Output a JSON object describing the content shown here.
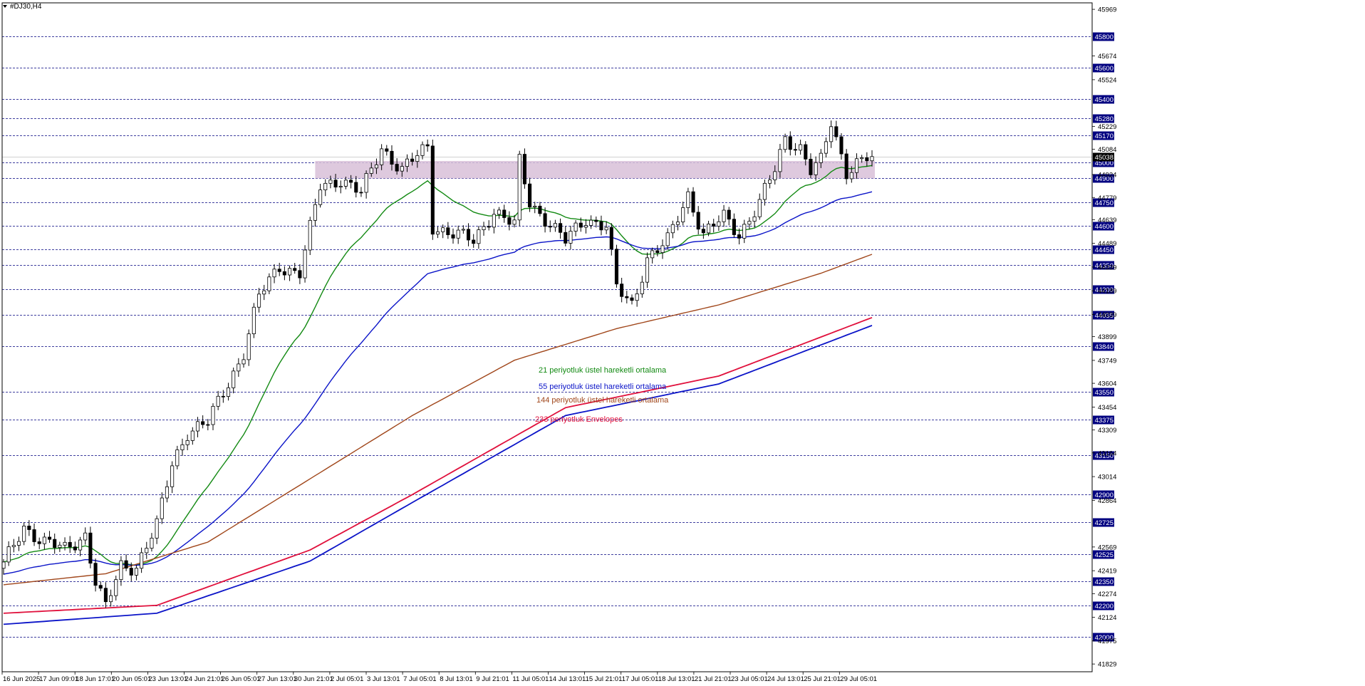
{
  "window": {
    "symbol_title": "#DJ30,H4"
  },
  "chart_data": {
    "type": "candlestick",
    "price_axis_ticks": [
      45969,
      45674,
      45524,
      45229,
      45084,
      44924,
      44779,
      44639,
      44489,
      44339,
      44189,
      44039,
      43899,
      43749,
      43604,
      43454,
      43309,
      43164,
      43014,
      42864,
      42569,
      42419,
      42274,
      42124,
      41975,
      41829
    ],
    "level_lines": [
      45800,
      45600,
      45400,
      45280,
      45170,
      45000,
      44900,
      44750,
      44600,
      44450,
      44350,
      44200,
      44035,
      43840,
      43550,
      43375,
      43150,
      42900,
      42725,
      42525,
      42350,
      42200,
      42000
    ],
    "current_price": 45038,
    "ylim": [
      41780,
      46010
    ],
    "zone": {
      "from_date_index": 61,
      "to_date_index": 170,
      "low": 44900,
      "high": 45010,
      "color": "#d8bfd8"
    },
    "date_labels": [
      "16 Jun 2025",
      "17 Jun 09:01",
      "18 Jun 17:01",
      "20 Jun 05:01",
      "23 Jun 13:01",
      "24 Jun 21:01",
      "26 Jun 05:01",
      "27 Jun 13:01",
      "30 Jun 21:01",
      "2 Jul 05:01",
      "3 Jul 13:01",
      "7 Jul 05:01",
      "8 Jul 13:01",
      "9 Jul 21:01",
      "11 Jul 05:01",
      "14 Jul 13:01",
      "15 Jul 21:01",
      "17 Jul 05:01",
      "18 Jul 13:01",
      "21 Jul 21:01",
      "23 Jul 05:01",
      "24 Jul 13:01",
      "25 Jul 21:01",
      "29 Jul 05:01"
    ],
    "close_anchors": [
      [
        0,
        42450
      ],
      [
        4,
        42700
      ],
      [
        8,
        42600
      ],
      [
        12,
        42550
      ],
      [
        16,
        42650
      ],
      [
        18,
        42350
      ],
      [
        20,
        42180
      ],
      [
        23,
        42450
      ],
      [
        26,
        42450
      ],
      [
        30,
        42700
      ],
      [
        33,
        43100
      ],
      [
        36,
        43300
      ],
      [
        40,
        43350
      ],
      [
        43,
        43550
      ],
      [
        47,
        43800
      ],
      [
        50,
        44150
      ],
      [
        54,
        44350
      ],
      [
        58,
        44300
      ],
      [
        62,
        44850
      ],
      [
        66,
        44900
      ],
      [
        70,
        44800
      ],
      [
        74,
        45100
      ],
      [
        78,
        44950
      ],
      [
        83,
        45100
      ],
      [
        84,
        44600
      ],
      [
        88,
        44550
      ],
      [
        92,
        44500
      ],
      [
        96,
        44700
      ],
      [
        100,
        44600
      ],
      [
        101,
        45000
      ],
      [
        103,
        44750
      ],
      [
        106,
        44650
      ],
      [
        110,
        44500
      ],
      [
        114,
        44650
      ],
      [
        118,
        44600
      ],
      [
        120,
        44200
      ],
      [
        123,
        44100
      ],
      [
        126,
        44400
      ],
      [
        130,
        44500
      ],
      [
        134,
        44800
      ],
      [
        137,
        44550
      ],
      [
        141,
        44650
      ],
      [
        144,
        44550
      ],
      [
        148,
        44750
      ],
      [
        151,
        44950
      ],
      [
        153,
        45150
      ],
      [
        156,
        45100
      ],
      [
        158,
        44950
      ],
      [
        160,
        45000
      ],
      [
        162,
        45250
      ],
      [
        165,
        44950
      ],
      [
        167,
        45000
      ],
      [
        170,
        45038
      ]
    ],
    "candle_count": 171,
    "series": [
      {
        "name": "21 periyotluk üstel hareketli ortalama",
        "color": "#138a13",
        "period": 21
      },
      {
        "name": "55 periyotluk üstel hareketli ortalama",
        "color": "#0b14c8",
        "period": 55
      },
      {
        "name": "144 periyotluk üstel hareketli ortalama",
        "color": "#a0461a",
        "period": 144
      },
      {
        "name": "233 periyotluk Envelopes",
        "color": "#e0103c",
        "period": 233
      }
    ],
    "envelope_lines": {
      "upper": {
        "color": "#e0103c",
        "values": [
          [
            0,
            42150
          ],
          [
            30,
            42200
          ],
          [
            60,
            42550
          ],
          [
            80,
            42900
          ],
          [
            110,
            43450
          ],
          [
            140,
            43650
          ],
          [
            170,
            44020
          ]
        ]
      },
      "lower": {
        "color": "#0b14c8",
        "values": [
          [
            0,
            42080
          ],
          [
            30,
            42150
          ],
          [
            60,
            42480
          ],
          [
            80,
            42850
          ],
          [
            110,
            43400
          ],
          [
            140,
            43600
          ],
          [
            170,
            43970
          ]
        ]
      }
    },
    "ema144_values": [
      [
        0,
        42330
      ],
      [
        20,
        42400
      ],
      [
        40,
        42600
      ],
      [
        60,
        43000
      ],
      [
        80,
        43400
      ],
      [
        100,
        43750
      ],
      [
        120,
        43950
      ],
      [
        140,
        44100
      ],
      [
        160,
        44300
      ],
      [
        170,
        44420
      ]
    ],
    "grid": false
  }
}
